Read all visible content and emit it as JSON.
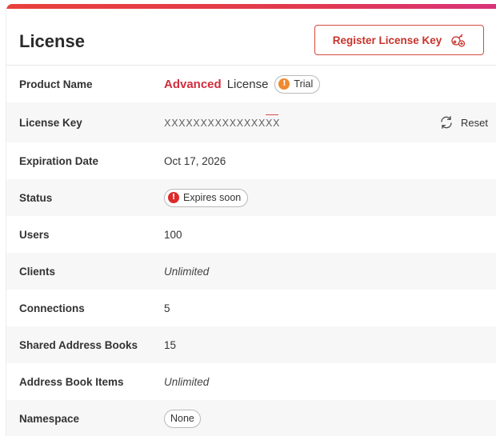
{
  "header": {
    "title": "License",
    "register_button": "Register License Key"
  },
  "colors": {
    "accent": "#e23a4e",
    "edition": "#d22d3d",
    "trial_dot": "#f0892f",
    "warning_dot": "#dd2a2a"
  },
  "rows": {
    "product_name": {
      "label": "Product Name",
      "edition": "Advanced",
      "suffix": "License",
      "badge": "Trial",
      "badge_icon": "exclamation-icon"
    },
    "license_key": {
      "label": "License Key",
      "value": "XXXXXXXXXXXXXXXX",
      "action": "Reset",
      "action_icon": "refresh-icon"
    },
    "expiration_date": {
      "label": "Expiration Date",
      "value": "Oct 17, 2026"
    },
    "status": {
      "label": "Status",
      "value": "Expires soon",
      "icon": "exclamation-icon"
    },
    "users": {
      "label": "Users",
      "value": "100"
    },
    "clients": {
      "label": "Clients",
      "value": "Unlimited"
    },
    "connections": {
      "label": "Connections",
      "value": "5"
    },
    "shared_address_books": {
      "label": "Shared Address Books",
      "value": "15"
    },
    "address_book_items": {
      "label": "Address Book Items",
      "value": "Unlimited"
    },
    "namespace": {
      "label": "Namespace",
      "value": "None"
    }
  }
}
